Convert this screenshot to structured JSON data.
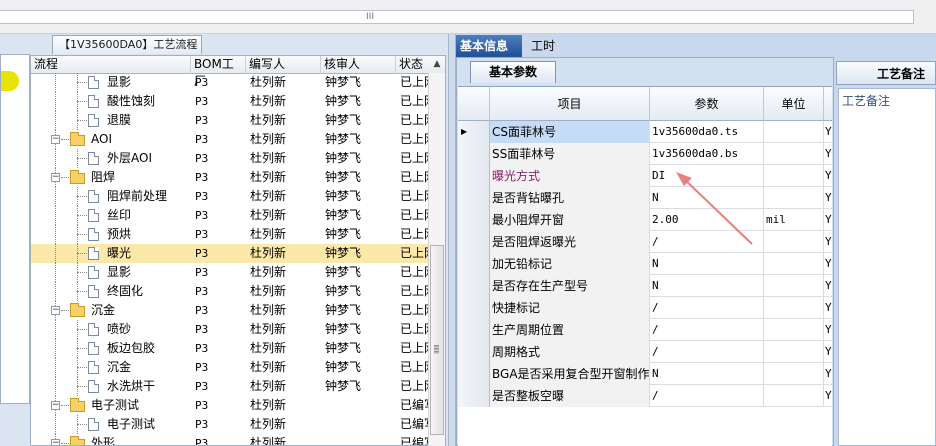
{
  "top": {
    "scroll_grip": "III"
  },
  "left": {
    "tab_title": "【1V35600DA0】工艺流程",
    "columns": [
      "流程",
      "BOM工厂",
      "编写人",
      "核审人",
      "状态"
    ],
    "rows": [
      {
        "name": "显影",
        "factory": "P3",
        "writer": "杜列新",
        "reviewer": "钟梦飞",
        "status": "已上网"
      },
      {
        "name": "酸性蚀刻",
        "factory": "P3",
        "writer": "杜列新",
        "reviewer": "钟梦飞",
        "status": "已上网"
      },
      {
        "name": "退膜",
        "factory": "P3",
        "writer": "杜列新",
        "reviewer": "钟梦飞",
        "status": "已上网"
      },
      {
        "name": "AOI",
        "factory": "P3",
        "writer": "杜列新",
        "reviewer": "钟梦飞",
        "status": "已上网"
      },
      {
        "name": "外层AOI",
        "factory": "P3",
        "writer": "杜列新",
        "reviewer": "钟梦飞",
        "status": "已上网"
      },
      {
        "name": "阻焊",
        "factory": "P3",
        "writer": "杜列新",
        "reviewer": "钟梦飞",
        "status": "已上网"
      },
      {
        "name": "阻焊前处理",
        "factory": "P3",
        "writer": "杜列新",
        "reviewer": "钟梦飞",
        "status": "已上网"
      },
      {
        "name": "丝印",
        "factory": "P3",
        "writer": "杜列新",
        "reviewer": "钟梦飞",
        "status": "已上网"
      },
      {
        "name": "预烘",
        "factory": "P3",
        "writer": "杜列新",
        "reviewer": "钟梦飞",
        "status": "已上网"
      },
      {
        "name": "曝光",
        "factory": "P3",
        "writer": "杜列新",
        "reviewer": "钟梦飞",
        "status": "已上网"
      },
      {
        "name": "显影",
        "factory": "P3",
        "writer": "杜列新",
        "reviewer": "钟梦飞",
        "status": "已上网"
      },
      {
        "name": "终固化",
        "factory": "P3",
        "writer": "杜列新",
        "reviewer": "钟梦飞",
        "status": "已上网"
      },
      {
        "name": "沉金",
        "factory": "P3",
        "writer": "杜列新",
        "reviewer": "钟梦飞",
        "status": "已上网"
      },
      {
        "name": "喷砂",
        "factory": "P3",
        "writer": "杜列新",
        "reviewer": "钟梦飞",
        "status": "已上网"
      },
      {
        "name": "板边包胶",
        "factory": "P3",
        "writer": "杜列新",
        "reviewer": "钟梦飞",
        "status": "已上网"
      },
      {
        "name": "沉金",
        "factory": "P3",
        "writer": "杜列新",
        "reviewer": "钟梦飞",
        "status": "已上网"
      },
      {
        "name": "水洗烘干",
        "factory": "P3",
        "writer": "杜列新",
        "reviewer": "钟梦飞",
        "status": "已上网"
      },
      {
        "name": "电子测试",
        "factory": "P3",
        "writer": "杜列新",
        "reviewer": "",
        "status": "已编写"
      },
      {
        "name": "电子测试",
        "factory": "P3",
        "writer": "杜列新",
        "reviewer": "",
        "status": "已编写"
      },
      {
        "name": "外形",
        "factory": "P3",
        "writer": "杜列新",
        "reviewer": "",
        "status": "已编写"
      }
    ]
  },
  "right": {
    "tabs": [
      "基本信息",
      "工时"
    ],
    "subtab": "基本参数",
    "grid_headers": [
      "项目",
      "参数",
      "单位"
    ],
    "grid_rows": [
      {
        "item": "CS面菲林号",
        "value": "1v35600da0.ts",
        "unit": "",
        "extra": "Y"
      },
      {
        "item": "SS面菲林号",
        "value": "1v35600da0.bs",
        "unit": "",
        "extra": "Y"
      },
      {
        "item": "曝光方式",
        "value": "DI",
        "unit": "",
        "extra": "Y"
      },
      {
        "item": "是否背钻曝孔",
        "value": "N",
        "unit": "",
        "extra": "Y"
      },
      {
        "item": "最小阻焊开窗",
        "value": "2.00",
        "unit": "mil",
        "extra": "Y"
      },
      {
        "item": "是否阻焊返曝光",
        "value": "/",
        "unit": "",
        "extra": "Y"
      },
      {
        "item": "加无铅标记",
        "value": "N",
        "unit": "",
        "extra": "Y"
      },
      {
        "item": "是否存在生产型号",
        "value": "N",
        "unit": "",
        "extra": "Y"
      },
      {
        "item": "快捷标记",
        "value": "/",
        "unit": "",
        "extra": "Y"
      },
      {
        "item": "生产周期位置",
        "value": "/",
        "unit": "",
        "extra": "Y"
      },
      {
        "item": "周期格式",
        "value": "/",
        "unit": "",
        "extra": "Y"
      },
      {
        "item": "BGA是否采用复合型开窗制作",
        "value": "N",
        "unit": "",
        "extra": "Y"
      },
      {
        "item": "是否整板空曝",
        "value": "/",
        "unit": "",
        "extra": "Y"
      }
    ]
  },
  "notes": {
    "tab": "工艺备注",
    "label": "工艺备注"
  },
  "colors": {
    "selected_row": "#fce8a8",
    "highlight_text": "#8b1c6b",
    "arrow": "#e88080",
    "tab_active": "#2a5ba3"
  },
  "icons": {
    "folder": "folder-icon",
    "file": "file-icon",
    "expand": "expand-toggle-icon"
  }
}
